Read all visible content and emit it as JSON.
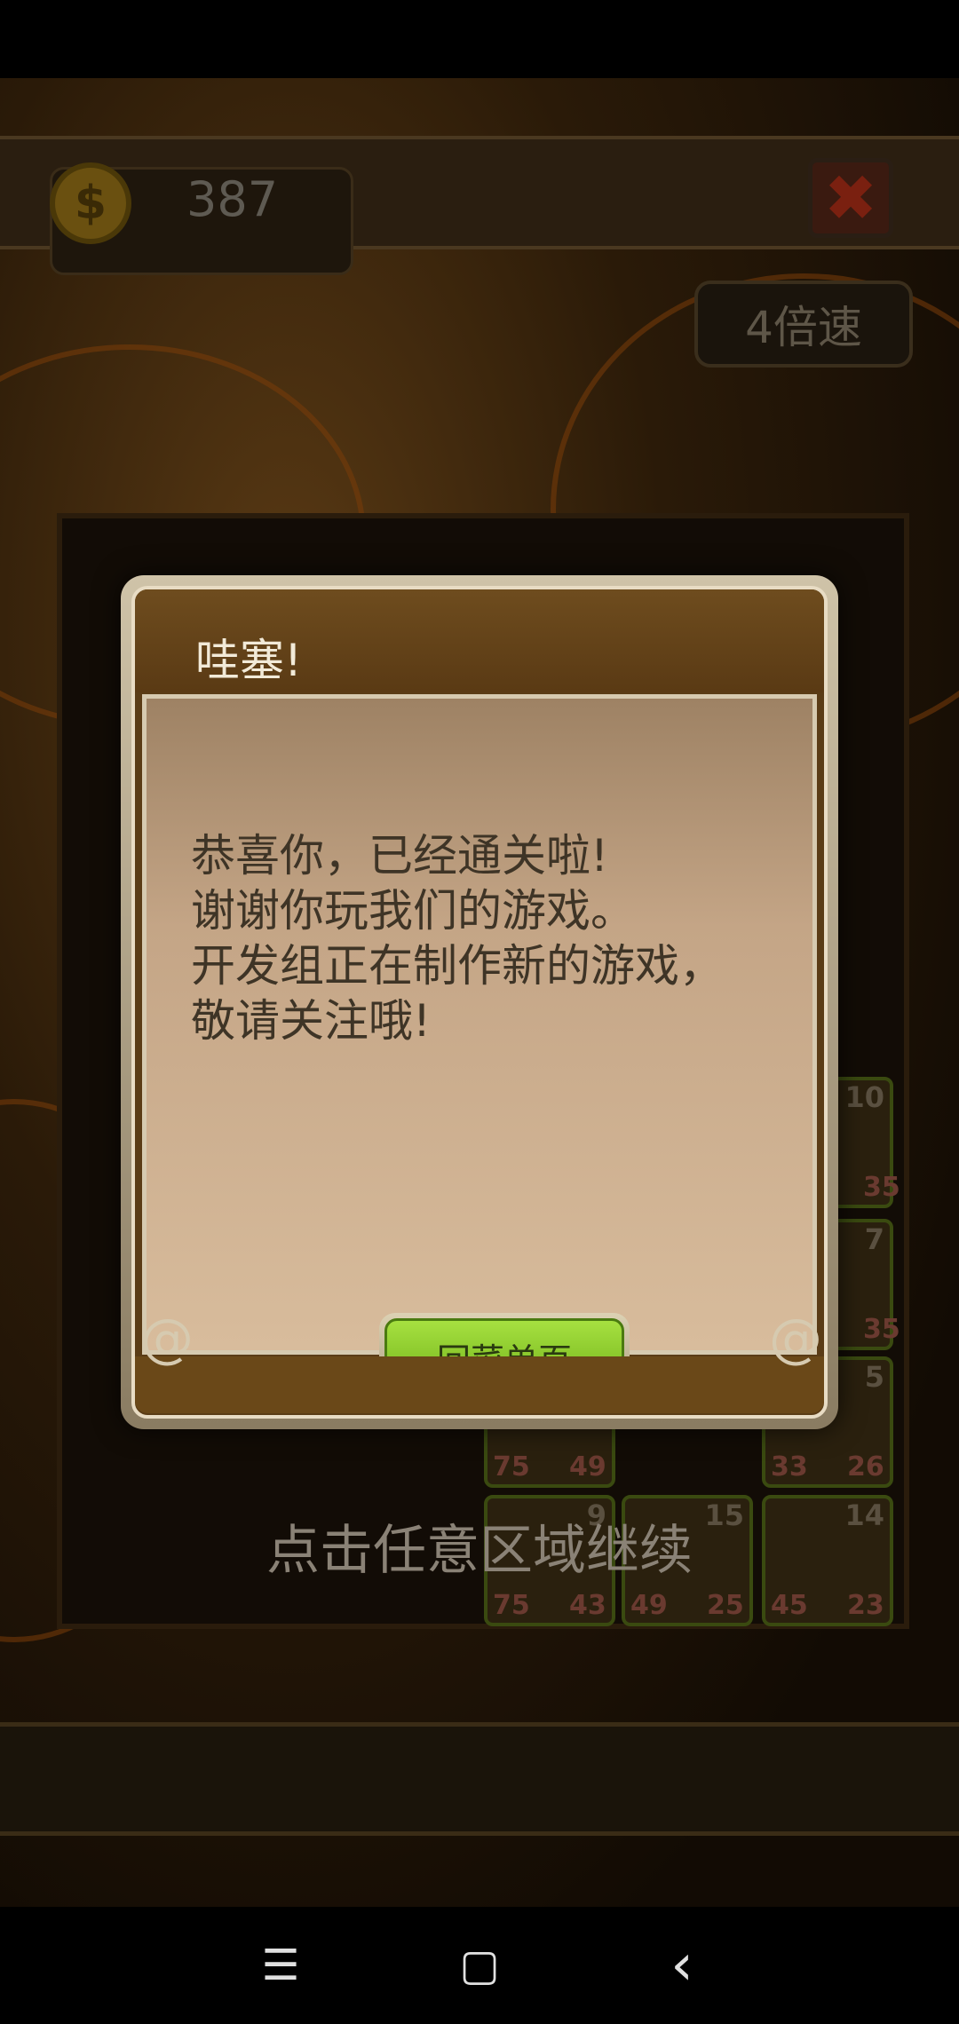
{
  "hud": {
    "coins": "387",
    "coin_symbol": "$",
    "close_symbol": "✖",
    "speed_label": "4倍速"
  },
  "board_units": [
    {
      "level": "10",
      "hp": "",
      "atk": "35"
    },
    {
      "level": "7",
      "hp": "",
      "atk": "35"
    },
    {
      "level": "5",
      "hp": "33",
      "atk": "26"
    },
    {
      "level": "",
      "hp": "75",
      "atk": "49"
    },
    {
      "level": "9",
      "hp": "75",
      "atk": "43"
    },
    {
      "level": "15",
      "hp": "49",
      "atk": "25"
    },
    {
      "level": "14",
      "hp": "45",
      "atk": "23"
    }
  ],
  "dialog": {
    "title": "哇塞!",
    "message": "恭喜你，已经通关啦!\n谢谢你玩我们的游戏。\n开发组正在制作新的游戏，\n敬请关注哦!",
    "button_label": "回菜单页"
  },
  "continue_hint": "点击任意区域继续",
  "nav": {
    "menu_icon": "☰",
    "home_icon": "▢",
    "back_icon": "‹"
  }
}
